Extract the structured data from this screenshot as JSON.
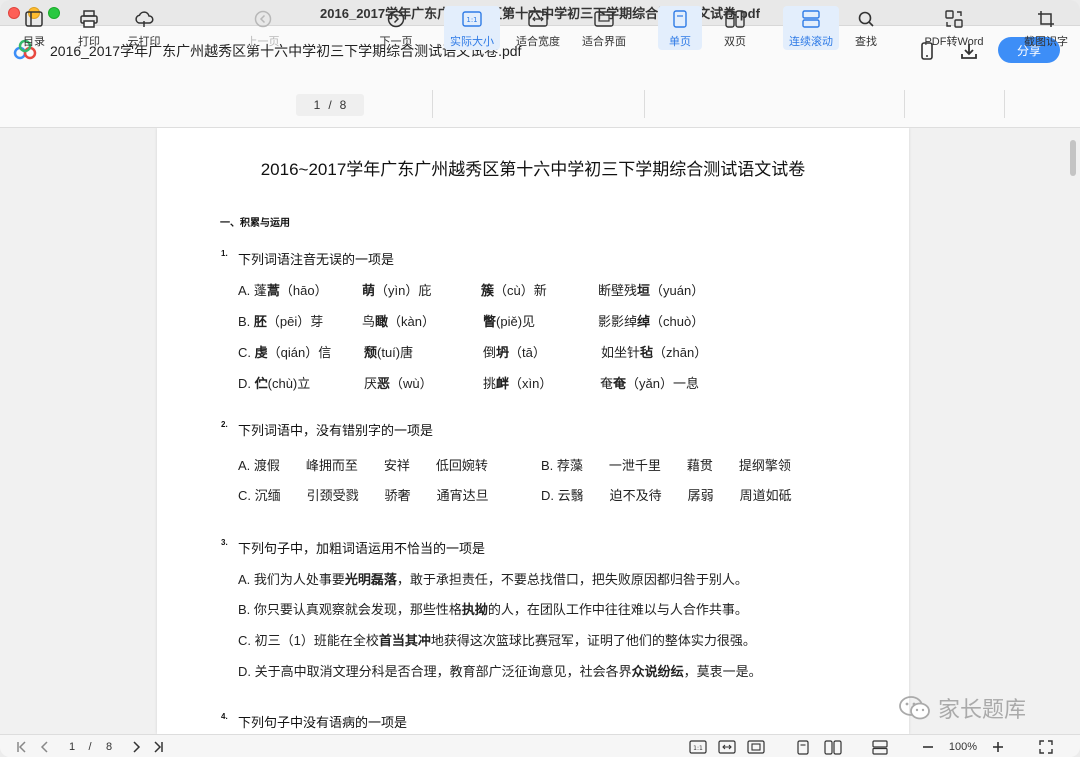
{
  "window": {
    "title": "2016_2017学年广东广州越秀区第十六中学初三下学期综合测试语文试卷.pdf"
  },
  "header": {
    "doc_title": "2016_2017学年广东广州越秀区第十六中学初三下学期综合测试语文试卷.pdf",
    "share_label": "分享",
    "icons": [
      "app-logo-icon",
      "phone-icon",
      "download-icon"
    ]
  },
  "toolbar": {
    "toc": "目录",
    "print": "打印",
    "cloud_print": "云打印",
    "prev": "上一页",
    "page_current": "1",
    "page_sep": "/",
    "page_total": "8",
    "next": "下一页",
    "actual_size": "实际大小",
    "actual_size_glyph": "1:1",
    "fit_width": "适合宽度",
    "fit_page": "适合界面",
    "single": "单页",
    "double": "双页",
    "continuous": "连续滚动",
    "find": "查找",
    "pdf_to_word": "PDF转Word",
    "ocr": "截图识字"
  },
  "document": {
    "title": "2016~2017学年广东广州越秀区第十六中学初三下学期综合测试语文试卷",
    "section1": "一、积累与运用",
    "questions": [
      {
        "num": "1.",
        "text": "下列词语注音无误的一项是",
        "options": [
          [
            "A. 蓬",
            "蒿",
            "（hāo）",
            "",
            "萌",
            "（yìn）庇",
            "",
            "簇",
            "（cù）新",
            "断壁残",
            "垣",
            "（yuán）"
          ],
          [
            "B. ",
            "胚",
            "（pēi）芽",
            "鸟",
            "瞰",
            "（kàn）",
            "",
            "瞥",
            "(piě)见",
            "影影绰",
            "绰",
            "（chuò）"
          ],
          [
            "C. ",
            "虔",
            "（qián）信",
            "",
            "颓",
            "(tuí)唐",
            "倒",
            "坍",
            "（tā）",
            "如坐针",
            "毡",
            "（zhān）"
          ],
          [
            "D. ",
            "伫",
            "(chù)立",
            "厌",
            "恶",
            "（wù）",
            "挑",
            "衅",
            "（xìn）",
            "奄",
            "奄",
            "（yǎn）一息"
          ]
        ]
      },
      {
        "num": "2.",
        "text": "下列词语中，没有错别字的一项是",
        "options": [
          "A. 渡假　　峰拥而至　　安祥　　低回婉转",
          "B. 荐藻　　一泄千里　　藉贯　　提纲擎领",
          "C. 沉缅　　引颈受戮　　骄奢　　通宵达旦",
          "D. 云翳　　迫不及待　　孱弱　　周道如砥"
        ]
      },
      {
        "num": "3.",
        "text": "下列句子中，加粗词语运用不恰当的一项是",
        "options": [
          [
            "A. 我们为人处事要",
            "光明磊落",
            "，敢于承担责任，不要总找借口，把失败原因都归咎于别人。"
          ],
          [
            "B. 你只要认真观察就会发现，那些性格",
            "执拗",
            "的人，在团队工作中往往难以与人合作共事。"
          ],
          [
            "C. 初三（1）班能在全校",
            "首当其冲",
            "地获得这次篮球比赛冠军，证明了他们的整体实力很强。"
          ],
          [
            "D. 关于高中取消文理分科是否合理，教育部广泛征询意见，社会各界",
            "众说纷纭",
            "，莫衷一是。"
          ]
        ]
      },
      {
        "num": "4.",
        "text": "下列句子中没有语病的一项是"
      }
    ]
  },
  "watermark": "家长题库",
  "statusbar": {
    "page_current": "1",
    "page_sep": "/",
    "page_total": "8",
    "zoom": "100%",
    "actual_glyph": "1:1"
  },
  "colors": {
    "accent": "#3d8ef7",
    "active_bg": "#e3eefc",
    "active_text": "#2f7be6"
  }
}
